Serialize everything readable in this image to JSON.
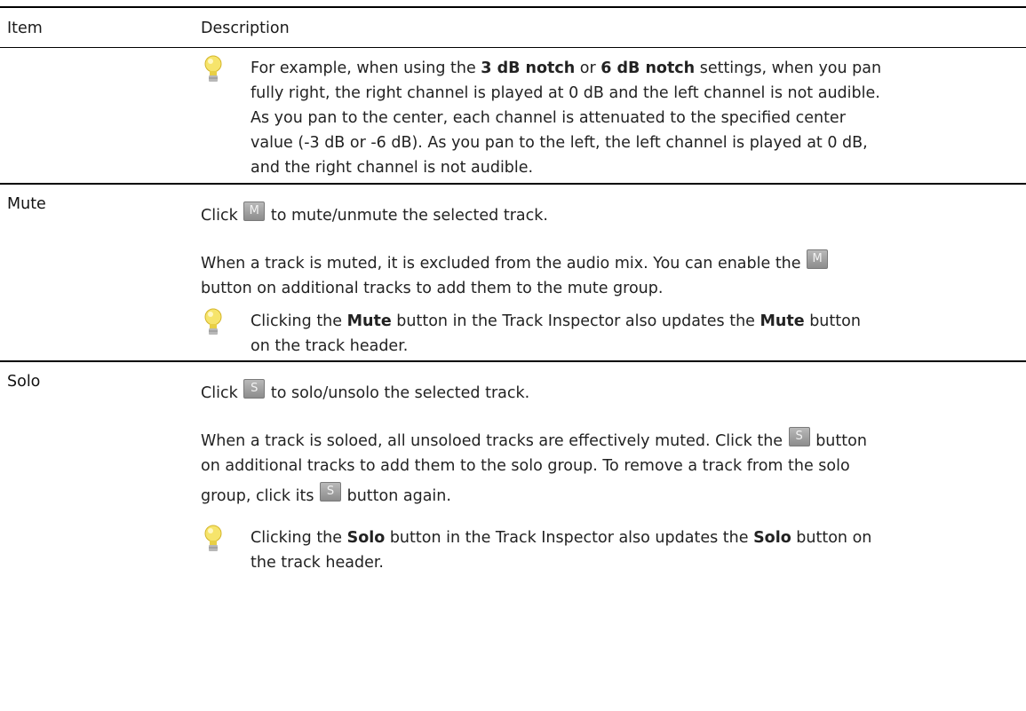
{
  "header": {
    "item": "Item",
    "description": "Description"
  },
  "tip_intro": {
    "pre1": "For example, when using the ",
    "b1": "3 dB notch",
    "mid1": " or ",
    "b2": "6 dB notch",
    "post1": " settings, when you pan",
    "line2": "fully right, the right channel is played at 0 dB and the left channel is not audible.",
    "line3": "As you pan to the center, each channel is attenuated to the specified center",
    "line4": "value (-3 dB or -6 dB). As you pan to the left, the left channel is played at 0 dB,",
    "line5": "and the right channel is not audible."
  },
  "mute": {
    "label": "Mute",
    "button_glyph": "M",
    "p1_pre": "Click ",
    "p1_post": " to mute/unmute the selected track.",
    "p2_line1_pre": "When a track is muted, it is excluded from the audio mix. You can enable the ",
    "p2_line2": "button on additional tracks to add them to the mute group.",
    "tip_pre": "Clicking the ",
    "tip_b1": "Mute",
    "tip_mid": " button in the Track Inspector also updates the ",
    "tip_b2": "Mute",
    "tip_post": " button",
    "tip_line2": "on the track header."
  },
  "solo": {
    "label": "Solo",
    "button_glyph": "S",
    "p1_pre": "Click ",
    "p1_post": " to solo/unsolo the selected track.",
    "p2_line1_pre": "When a track is soloed, all unsoloed tracks are effectively muted. Click the ",
    "p2_line1_post": " button",
    "p2_line2": "on additional tracks to add them to the solo group. To remove a track from the solo",
    "p2_line3_pre": "group, click its ",
    "p2_line3_post": " button again.",
    "tip_pre": "Clicking the ",
    "tip_b1": "Solo",
    "tip_mid": " button in the Track Inspector also updates the ",
    "tip_b2": "Solo",
    "tip_post": " button on",
    "tip_line2": "the track header."
  },
  "colors": {
    "rule": "#000000",
    "text": "#222222",
    "bulb": "#f3df5a",
    "button": "#9e9e9e"
  },
  "icons": {
    "tip": "lightbulb-icon",
    "mute_button": "mute-button-icon",
    "solo_button": "solo-button-icon"
  }
}
